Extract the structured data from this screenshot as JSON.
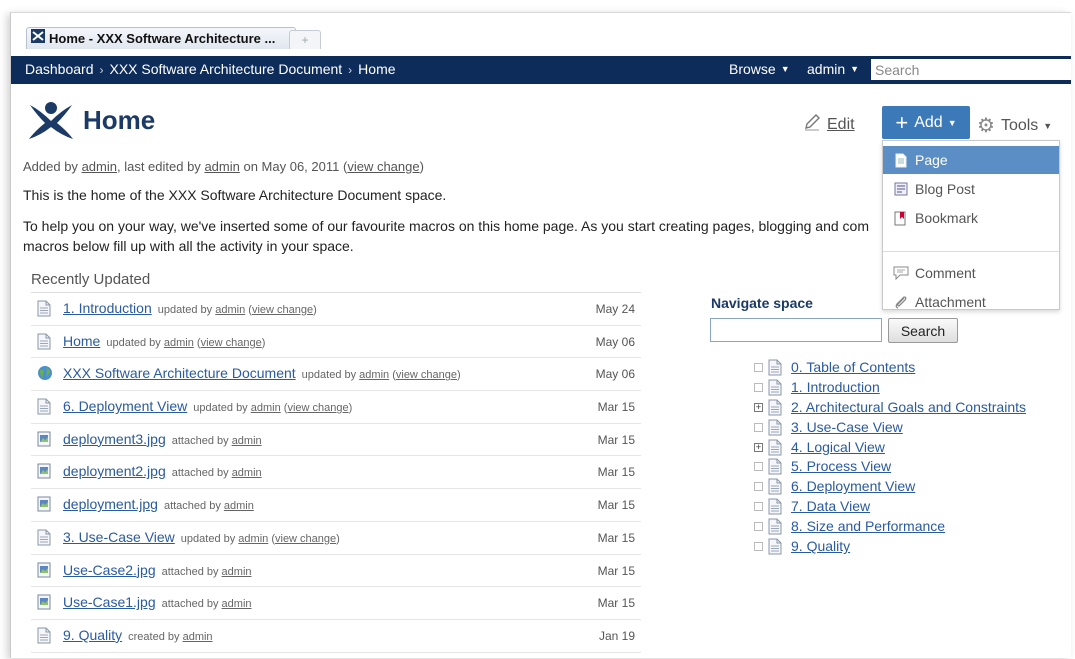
{
  "browser": {
    "tab_title": "Home - XXX Software Architecture ...",
    "new_tab_label": "+"
  },
  "header": {
    "breadcrumbs": [
      "Dashboard",
      "XXX Software Architecture Document",
      "Home"
    ],
    "browse_label": "Browse",
    "user_label": "admin",
    "search_placeholder": "Search"
  },
  "page": {
    "title": "Home",
    "meta": {
      "prefix": "Added by",
      "creator": "admin",
      "mid": ", last edited by",
      "editor": "admin",
      "on": "on May 06, 2011",
      "view_change": "view change"
    },
    "intro": "This is the home of the XXX Software Architecture Document space.",
    "help_line1": "To help you on your way, we've inserted some of our favourite macros on this home page. As you start creating pages, blogging and com",
    "help_line2": "macros below fill up with all the activity in your space."
  },
  "toolbar": {
    "edit_label": "Edit",
    "add_label": "Add",
    "tools_label": "Tools"
  },
  "add_menu": {
    "items": [
      {
        "label": "Page",
        "icon": "page-icon"
      },
      {
        "label": "Blog Post",
        "icon": "blog-post-icon"
      },
      {
        "label": "Bookmark",
        "icon": "bookmark-icon"
      },
      {
        "label": "Comment",
        "icon": "comment-icon"
      },
      {
        "label": "Attachment",
        "icon": "attachment-icon"
      }
    ]
  },
  "recently_updated": {
    "title": "Recently Updated",
    "items": [
      {
        "name": "1. Introduction",
        "action": "updated by",
        "user": "admin",
        "view_change": "view change",
        "date": "May 24",
        "icon": "page-icon"
      },
      {
        "name": "Home",
        "action": "updated by",
        "user": "admin",
        "view_change": "view change",
        "date": "May 06",
        "icon": "page-icon"
      },
      {
        "name": "XXX Software Architecture Document",
        "action": "updated by",
        "user": "admin",
        "view_change": "view change",
        "date": "May 06",
        "icon": "globe-icon"
      },
      {
        "name": "6. Deployment View",
        "action": "updated by",
        "user": "admin",
        "view_change": "view change",
        "date": "Mar 15",
        "icon": "page-icon"
      },
      {
        "name": "deployment3.jpg",
        "action": "attached by",
        "user": "admin",
        "date": "Mar 15",
        "icon": "image-file-icon"
      },
      {
        "name": "deployment2.jpg",
        "action": "attached by",
        "user": "admin",
        "date": "Mar 15",
        "icon": "image-file-icon"
      },
      {
        "name": "deployment.jpg",
        "action": "attached by",
        "user": "admin",
        "date": "Mar 15",
        "icon": "image-file-icon"
      },
      {
        "name": "3. Use-Case View",
        "action": "updated by",
        "user": "admin",
        "view_change": "view change",
        "date": "Mar 15",
        "icon": "page-icon"
      },
      {
        "name": "Use-Case2.jpg",
        "action": "attached by",
        "user": "admin",
        "date": "Mar 15",
        "icon": "image-file-icon"
      },
      {
        "name": "Use-Case1.jpg",
        "action": "attached by",
        "user": "admin",
        "date": "Mar 15",
        "icon": "image-file-icon"
      },
      {
        "name": "9. Quality",
        "action": "created by",
        "user": "admin",
        "date": "Jan 19",
        "icon": "page-icon"
      }
    ]
  },
  "navigate": {
    "title": "Navigate space",
    "search_button": "Search",
    "tree": [
      {
        "label": "0. Table of Contents",
        "expandable": false
      },
      {
        "label": "1. Introduction",
        "expandable": false
      },
      {
        "label": "2. Architectural Goals and Constraints",
        "expandable": true
      },
      {
        "label": "3. Use-Case View",
        "expandable": false
      },
      {
        "label": "4. Logical View",
        "expandable": true
      },
      {
        "label": "5. Process View",
        "expandable": false
      },
      {
        "label": "6. Deployment View",
        "expandable": false
      },
      {
        "label": "7. Data View",
        "expandable": false
      },
      {
        "label": "8. Size and Performance",
        "expandable": false
      },
      {
        "label": "9. Quality",
        "expandable": false
      }
    ]
  },
  "colors": {
    "header_bg": "#0d2c5a",
    "accent": "#3b79b8",
    "menu_selected": "#5a8ec4",
    "link": "#2a5aa0"
  }
}
